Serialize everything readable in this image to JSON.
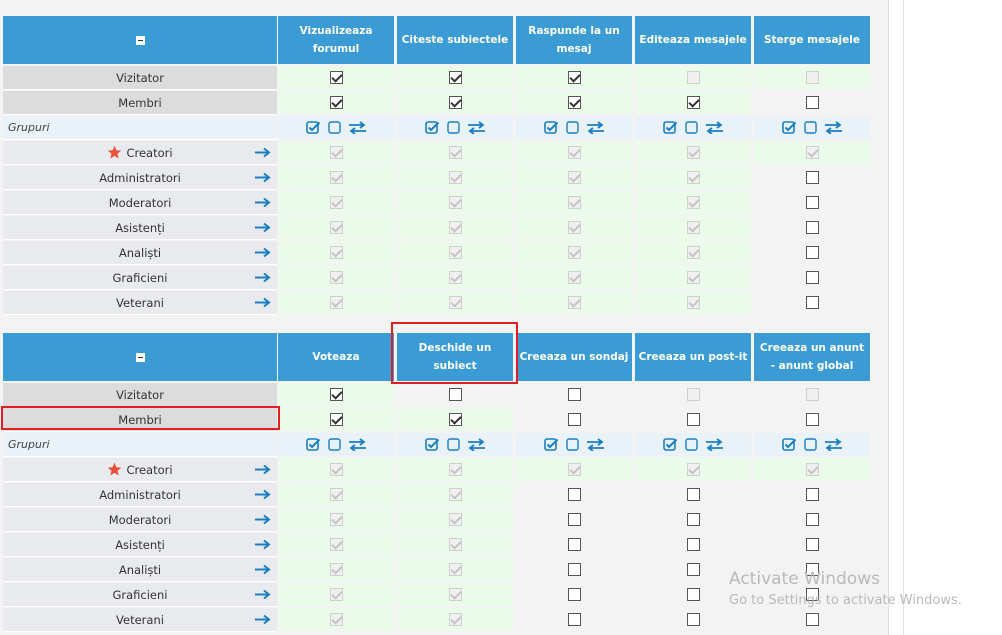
{
  "colors": {
    "header": "#3a9bd5",
    "allowed": "#eafbea",
    "highlight": "#e02020",
    "icon": "#1a7fc1"
  },
  "tables": [
    {
      "headers": [
        "Vizualizeaza forumul",
        "Citeste subiectele",
        "Raspunde la un mesaj",
        "Editeaza mesajele",
        "Sterge mesajele"
      ],
      "group_label": "Grupuri",
      "user_rows": [
        {
          "label": "Vizitator",
          "cells": [
            [
              1,
              1,
              0
            ],
            [
              1,
              1,
              0
            ],
            [
              1,
              1,
              0
            ],
            [
              1,
              0,
              1
            ],
            [
              1,
              0,
              1
            ]
          ]
        },
        {
          "label": "Membri",
          "cells": [
            [
              1,
              1,
              0
            ],
            [
              1,
              1,
              0
            ],
            [
              1,
              1,
              0
            ],
            [
              1,
              1,
              0
            ],
            [
              0,
              0,
              0
            ]
          ]
        }
      ],
      "group_rows": [
        {
          "label": "Creatori",
          "star": true,
          "cells": [
            [
              1,
              1,
              1
            ],
            [
              1,
              1,
              1
            ],
            [
              1,
              1,
              1
            ],
            [
              1,
              1,
              1
            ],
            [
              1,
              1,
              1
            ]
          ]
        },
        {
          "label": "Administratori",
          "cells": [
            [
              1,
              1,
              1
            ],
            [
              1,
              1,
              1
            ],
            [
              1,
              1,
              1
            ],
            [
              1,
              1,
              1
            ],
            [
              0,
              0,
              0
            ]
          ]
        },
        {
          "label": "Moderatori",
          "cells": [
            [
              1,
              1,
              1
            ],
            [
              1,
              1,
              1
            ],
            [
              1,
              1,
              1
            ],
            [
              1,
              1,
              1
            ],
            [
              0,
              0,
              0
            ]
          ]
        },
        {
          "label": "Asistenți",
          "cells": [
            [
              1,
              1,
              1
            ],
            [
              1,
              1,
              1
            ],
            [
              1,
              1,
              1
            ],
            [
              1,
              1,
              1
            ],
            [
              0,
              0,
              0
            ]
          ]
        },
        {
          "label": "Analiști",
          "cells": [
            [
              1,
              1,
              1
            ],
            [
              1,
              1,
              1
            ],
            [
              1,
              1,
              1
            ],
            [
              1,
              1,
              1
            ],
            [
              0,
              0,
              0
            ]
          ]
        },
        {
          "label": "Graficieni",
          "cells": [
            [
              1,
              1,
              1
            ],
            [
              1,
              1,
              1
            ],
            [
              1,
              1,
              1
            ],
            [
              1,
              1,
              1
            ],
            [
              0,
              0,
              0
            ]
          ]
        },
        {
          "label": "Veterani",
          "cells": [
            [
              1,
              1,
              1
            ],
            [
              1,
              1,
              1
            ],
            [
              1,
              1,
              1
            ],
            [
              1,
              1,
              1
            ],
            [
              0,
              0,
              0
            ]
          ]
        }
      ]
    },
    {
      "headers": [
        "Voteaza",
        "Deschide un subiect",
        "Creeaza un sondaj",
        "Creeaza un post-it",
        "Creeaza un anunt - anunt global"
      ],
      "group_label": "Grupuri",
      "user_rows": [
        {
          "label": "Vizitator",
          "cells": [
            [
              1,
              1,
              0
            ],
            [
              0,
              0,
              0
            ],
            [
              0,
              0,
              0
            ],
            [
              0,
              0,
              1
            ],
            [
              0,
              0,
              1
            ]
          ]
        },
        {
          "label": "Membri",
          "cells": [
            [
              1,
              1,
              0
            ],
            [
              1,
              1,
              0
            ],
            [
              0,
              0,
              0
            ],
            [
              0,
              0,
              0
            ],
            [
              0,
              0,
              0
            ]
          ]
        }
      ],
      "group_rows": [
        {
          "label": "Creatori",
          "star": true,
          "cells": [
            [
              1,
              1,
              1
            ],
            [
              1,
              1,
              1
            ],
            [
              1,
              1,
              1
            ],
            [
              1,
              1,
              1
            ],
            [
              1,
              1,
              1
            ]
          ]
        },
        {
          "label": "Administratori",
          "cells": [
            [
              1,
              1,
              1
            ],
            [
              1,
              1,
              1
            ],
            [
              0,
              0,
              0
            ],
            [
              0,
              0,
              0
            ],
            [
              0,
              0,
              0
            ]
          ]
        },
        {
          "label": "Moderatori",
          "cells": [
            [
              1,
              1,
              1
            ],
            [
              1,
              1,
              1
            ],
            [
              0,
              0,
              0
            ],
            [
              0,
              0,
              0
            ],
            [
              0,
              0,
              0
            ]
          ]
        },
        {
          "label": "Asistenți",
          "cells": [
            [
              1,
              1,
              1
            ],
            [
              1,
              1,
              1
            ],
            [
              0,
              0,
              0
            ],
            [
              0,
              0,
              0
            ],
            [
              0,
              0,
              0
            ]
          ]
        },
        {
          "label": "Analiști",
          "cells": [
            [
              1,
              1,
              1
            ],
            [
              1,
              1,
              1
            ],
            [
              0,
              0,
              0
            ],
            [
              0,
              0,
              0
            ],
            [
              0,
              0,
              0
            ]
          ]
        },
        {
          "label": "Graficieni",
          "cells": [
            [
              1,
              1,
              1
            ],
            [
              1,
              1,
              1
            ],
            [
              0,
              0,
              0
            ],
            [
              0,
              0,
              0
            ],
            [
              0,
              0,
              0
            ]
          ]
        },
        {
          "label": "Veterani",
          "cells": [
            [
              1,
              1,
              1
            ],
            [
              1,
              1,
              1
            ],
            [
              0,
              0,
              0
            ],
            [
              0,
              0,
              0
            ],
            [
              0,
              0,
              0
            ]
          ]
        }
      ]
    }
  ],
  "watermark": {
    "title": "Activate Windows",
    "subtitle": "Go to Settings to activate Windows."
  }
}
